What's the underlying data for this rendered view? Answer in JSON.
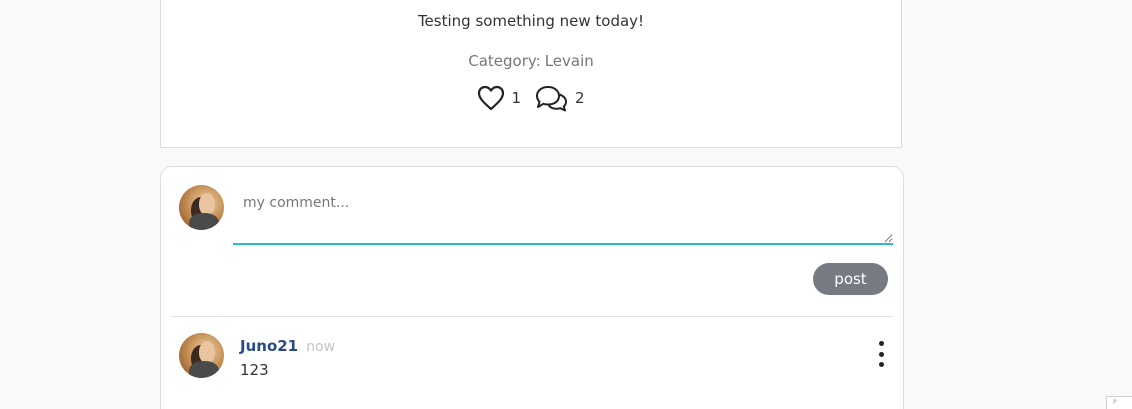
{
  "post": {
    "text": "Testing something new today!",
    "category_label": "Category:",
    "category_value": "Levain",
    "likes_count": "1",
    "comments_count": "2",
    "icons": {
      "like": "heart-icon",
      "comments": "chat-bubbles-icon"
    }
  },
  "comment_form": {
    "placeholder": "my comment...",
    "post_label": "post"
  },
  "comments": [
    {
      "author": "Juno21",
      "time": "now",
      "body": "123"
    }
  ],
  "corner_badge": {
    "text": "P"
  },
  "colors": {
    "background": "#f8f9f8",
    "accent_underline": "#2bb7d6",
    "post_button": "#767a82",
    "author_link": "#2a4a86",
    "timestamp": "#c6c6c6"
  }
}
